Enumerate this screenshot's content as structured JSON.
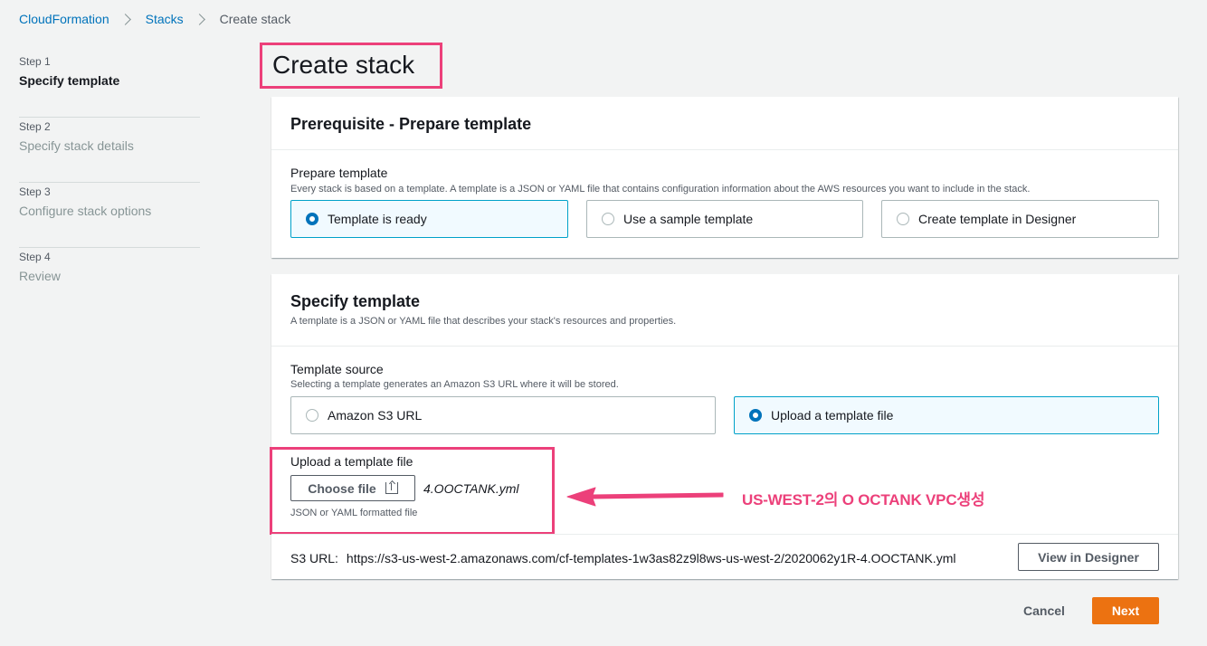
{
  "breadcrumb": {
    "items": [
      "CloudFormation",
      "Stacks",
      "Create stack"
    ]
  },
  "steps": [
    {
      "num": "Step 1",
      "title": "Specify template",
      "active": true
    },
    {
      "num": "Step 2",
      "title": "Specify stack details",
      "active": false
    },
    {
      "num": "Step 3",
      "title": "Configure stack options",
      "active": false
    },
    {
      "num": "Step 4",
      "title": "Review",
      "active": false
    }
  ],
  "page_title": "Create stack",
  "prerequisite": {
    "heading": "Prerequisite - Prepare template",
    "label": "Prepare template",
    "description": "Every stack is based on a template. A template is a JSON or YAML file that contains configuration information about the AWS resources you want to include in the stack.",
    "options": [
      "Template is ready",
      "Use a sample template",
      "Create template in Designer"
    ],
    "selected_index": 0
  },
  "specify": {
    "heading": "Specify template",
    "description": "A template is a JSON or YAML file that describes your stack's resources and properties.",
    "source_label": "Template source",
    "source_description": "Selecting a template generates an Amazon S3 URL where it will be stored.",
    "source_options": [
      "Amazon S3 URL",
      "Upload a template file"
    ],
    "selected_index": 1,
    "upload_label": "Upload a template file",
    "choose_file_label": "Choose file",
    "file_name": "4.OOCTANK.yml",
    "file_hint": "JSON or YAML formatted file",
    "s3_url_label": "S3 URL:",
    "s3_url": "https://s3-us-west-2.amazonaws.com/cf-templates-1w3as82z9l8ws-us-west-2/2020062y1R-4.OOCTANK.yml",
    "view_designer_label": "View in Designer"
  },
  "annotation": {
    "text": "US-WEST-2의 O OCTANK VPC생성",
    "color": "#ec407a"
  },
  "footer": {
    "cancel_label": "Cancel",
    "next_label": "Next"
  },
  "colors": {
    "accent": "#0073bb",
    "primary_button": "#ec7211",
    "highlight_box": "#ec407a"
  }
}
